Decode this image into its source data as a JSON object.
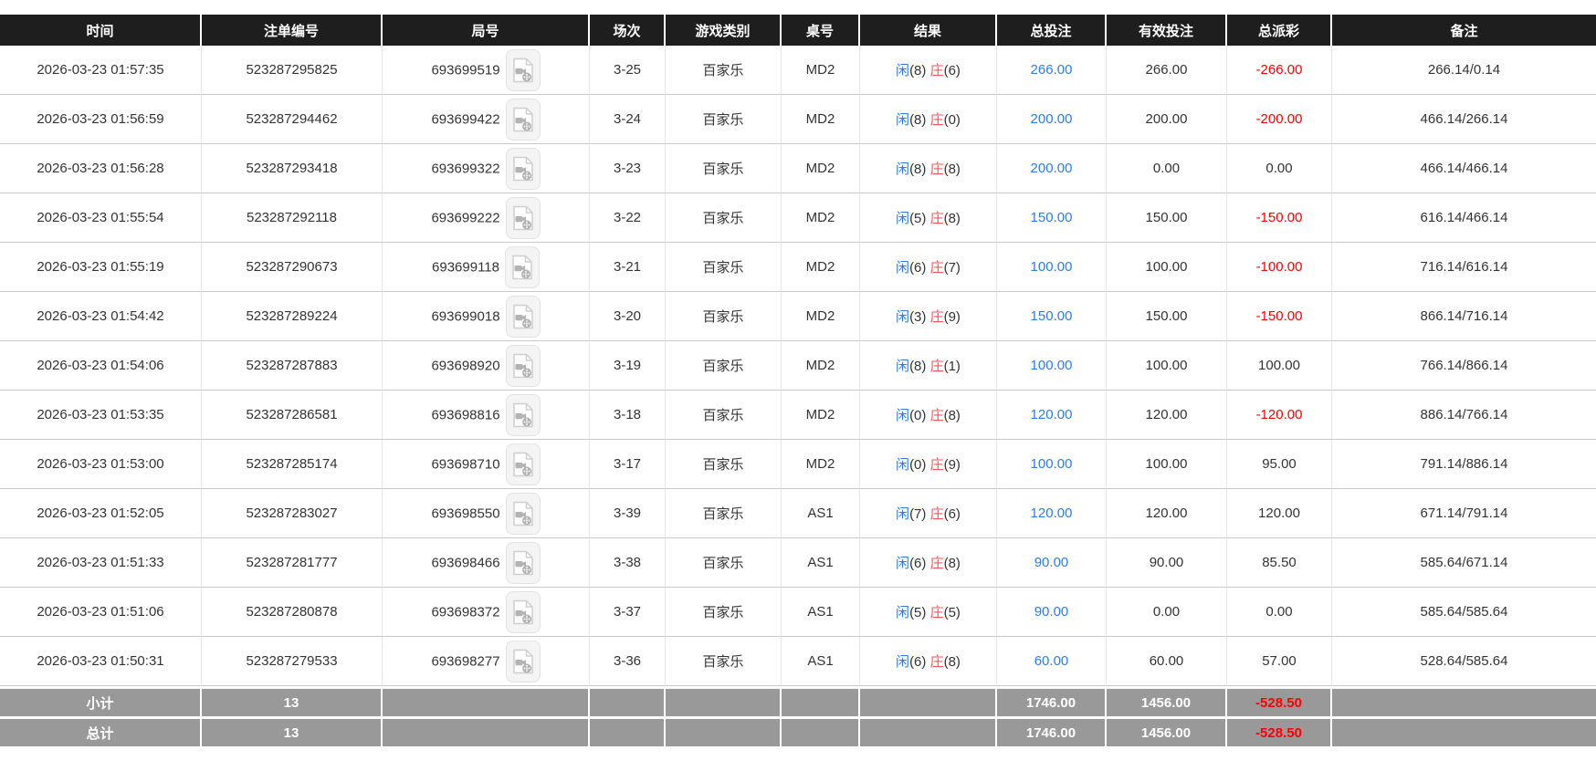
{
  "colors": {
    "header_bg": "#1e1e1e",
    "footer_bg": "#999999",
    "link_blue": "#2b7cf0",
    "player_blue": "#2b7cf0",
    "banker_red": "#ff5252",
    "negative_red": "#ff0000"
  },
  "icons": {
    "video_replay": "video-replay-icon"
  },
  "table": {
    "columns": [
      {
        "key": "time",
        "label": "时间"
      },
      {
        "key": "bet_id",
        "label": "注单编号"
      },
      {
        "key": "round",
        "label": "局号"
      },
      {
        "key": "session",
        "label": "场次"
      },
      {
        "key": "game",
        "label": "游戏类别"
      },
      {
        "key": "table_no",
        "label": "桌号"
      },
      {
        "key": "result",
        "label": "结果"
      },
      {
        "key": "total_bet",
        "label": "总投注"
      },
      {
        "key": "valid_bet",
        "label": "有效投注"
      },
      {
        "key": "payout",
        "label": "总派彩"
      },
      {
        "key": "remark",
        "label": "备注"
      }
    ],
    "rows": [
      {
        "time": "2026-03-23 01:57:35",
        "bet_id": "523287295825",
        "round": "693699519",
        "session": "3-25",
        "game": "百家乐",
        "table_no": "MD2",
        "player": "闲",
        "player_score": "(8)",
        "banker": "庄",
        "banker_score": "(6)",
        "total_bet": "266.00",
        "valid_bet": "266.00",
        "payout": "-266.00",
        "remark": "266.14/0.14"
      },
      {
        "time": "2026-03-23 01:56:59",
        "bet_id": "523287294462",
        "round": "693699422",
        "session": "3-24",
        "game": "百家乐",
        "table_no": "MD2",
        "player": "闲",
        "player_score": "(8)",
        "banker": "庄",
        "banker_score": "(0)",
        "total_bet": "200.00",
        "valid_bet": "200.00",
        "payout": "-200.00",
        "remark": "466.14/266.14"
      },
      {
        "time": "2026-03-23 01:56:28",
        "bet_id": "523287293418",
        "round": "693699322",
        "session": "3-23",
        "game": "百家乐",
        "table_no": "MD2",
        "player": "闲",
        "player_score": "(8)",
        "banker": "庄",
        "banker_score": "(8)",
        "total_bet": "200.00",
        "valid_bet": "0.00",
        "payout": "0.00",
        "remark": "466.14/466.14"
      },
      {
        "time": "2026-03-23 01:55:54",
        "bet_id": "523287292118",
        "round": "693699222",
        "session": "3-22",
        "game": "百家乐",
        "table_no": "MD2",
        "player": "闲",
        "player_score": "(5)",
        "banker": "庄",
        "banker_score": "(8)",
        "total_bet": "150.00",
        "valid_bet": "150.00",
        "payout": "-150.00",
        "remark": "616.14/466.14"
      },
      {
        "time": "2026-03-23 01:55:19",
        "bet_id": "523287290673",
        "round": "693699118",
        "session": "3-21",
        "game": "百家乐",
        "table_no": "MD2",
        "player": "闲",
        "player_score": "(6)",
        "banker": "庄",
        "banker_score": "(7)",
        "total_bet": "100.00",
        "valid_bet": "100.00",
        "payout": "-100.00",
        "remark": "716.14/616.14"
      },
      {
        "time": "2026-03-23 01:54:42",
        "bet_id": "523287289224",
        "round": "693699018",
        "session": "3-20",
        "game": "百家乐",
        "table_no": "MD2",
        "player": "闲",
        "player_score": "(3)",
        "banker": "庄",
        "banker_score": "(9)",
        "total_bet": "150.00",
        "valid_bet": "150.00",
        "payout": "-150.00",
        "remark": "866.14/716.14"
      },
      {
        "time": "2026-03-23 01:54:06",
        "bet_id": "523287287883",
        "round": "693698920",
        "session": "3-19",
        "game": "百家乐",
        "table_no": "MD2",
        "player": "闲",
        "player_score": "(8)",
        "banker": "庄",
        "banker_score": "(1)",
        "total_bet": "100.00",
        "valid_bet": "100.00",
        "payout": "100.00",
        "remark": "766.14/866.14"
      },
      {
        "time": "2026-03-23 01:53:35",
        "bet_id": "523287286581",
        "round": "693698816",
        "session": "3-18",
        "game": "百家乐",
        "table_no": "MD2",
        "player": "闲",
        "player_score": "(0)",
        "banker": "庄",
        "banker_score": "(8)",
        "total_bet": "120.00",
        "valid_bet": "120.00",
        "payout": "-120.00",
        "remark": "886.14/766.14"
      },
      {
        "time": "2026-03-23 01:53:00",
        "bet_id": "523287285174",
        "round": "693698710",
        "session": "3-17",
        "game": "百家乐",
        "table_no": "MD2",
        "player": "闲",
        "player_score": "(0)",
        "banker": "庄",
        "banker_score": "(9)",
        "total_bet": "100.00",
        "valid_bet": "100.00",
        "payout": "95.00",
        "remark": "791.14/886.14"
      },
      {
        "time": "2026-03-23 01:52:05",
        "bet_id": "523287283027",
        "round": "693698550",
        "session": "3-39",
        "game": "百家乐",
        "table_no": "AS1",
        "player": "闲",
        "player_score": "(7)",
        "banker": "庄",
        "banker_score": "(6)",
        "total_bet": "120.00",
        "valid_bet": "120.00",
        "payout": "120.00",
        "remark": "671.14/791.14"
      },
      {
        "time": "2026-03-23 01:51:33",
        "bet_id": "523287281777",
        "round": "693698466",
        "session": "3-38",
        "game": "百家乐",
        "table_no": "AS1",
        "player": "闲",
        "player_score": "(6)",
        "banker": "庄",
        "banker_score": "(8)",
        "total_bet": "90.00",
        "valid_bet": "90.00",
        "payout": "85.50",
        "remark": "585.64/671.14"
      },
      {
        "time": "2026-03-23 01:51:06",
        "bet_id": "523287280878",
        "round": "693698372",
        "session": "3-37",
        "game": "百家乐",
        "table_no": "AS1",
        "player": "闲",
        "player_score": "(5)",
        "banker": "庄",
        "banker_score": "(5)",
        "total_bet": "90.00",
        "valid_bet": "0.00",
        "payout": "0.00",
        "remark": "585.64/585.64"
      },
      {
        "time": "2026-03-23 01:50:31",
        "bet_id": "523287279533",
        "round": "693698277",
        "session": "3-36",
        "game": "百家乐",
        "table_no": "AS1",
        "player": "闲",
        "player_score": "(6)",
        "banker": "庄",
        "banker_score": "(8)",
        "total_bet": "60.00",
        "valid_bet": "60.00",
        "payout": "57.00",
        "remark": "528.64/585.64"
      }
    ],
    "footer": [
      {
        "label": "小计",
        "count": "13",
        "total_bet": "1746.00",
        "valid_bet": "1456.00",
        "payout": "-528.50"
      },
      {
        "label": "总计",
        "count": "13",
        "total_bet": "1746.00",
        "valid_bet": "1456.00",
        "payout": "-528.50"
      }
    ]
  }
}
